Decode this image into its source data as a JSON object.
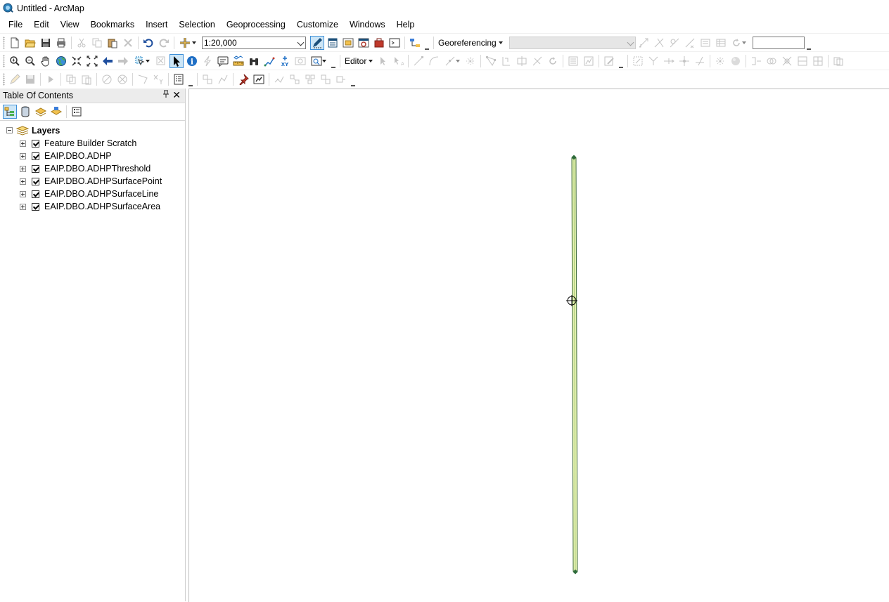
{
  "window": {
    "title": "Untitled - ArcMap"
  },
  "menu": [
    "File",
    "Edit",
    "View",
    "Bookmarks",
    "Insert",
    "Selection",
    "Geoprocessing",
    "Customize",
    "Windows",
    "Help"
  ],
  "toolbar": {
    "scale_value": "1:20,000",
    "georeferencing_label": "Georeferencing",
    "georeferencing_layer": "",
    "rotation_value": "",
    "editor_label": "Editor"
  },
  "toc": {
    "title": "Table Of Contents",
    "root": {
      "label": "Layers"
    },
    "layers": [
      {
        "label": "Feature Builder Scratch",
        "checked": true
      },
      {
        "label": "EAIP.DBO.ADHP",
        "checked": true
      },
      {
        "label": "EAIP.DBO.ADHPThreshold",
        "checked": true
      },
      {
        "label": "EAIP.DBO.ADHPSurfacePoint",
        "checked": true
      },
      {
        "label": "EAIP.DBO.ADHPSurfaceLine",
        "checked": true
      },
      {
        "label": "EAIP.DBO.ADHPSurfaceArea",
        "checked": true
      }
    ]
  },
  "map": {
    "feature_fill": "#e3f0b0",
    "feature_stroke": "#3d6b3a",
    "vertex_color": "#2e6b3a"
  },
  "colors": {
    "accent": "#3d8fd8",
    "panel": "#ececec"
  }
}
